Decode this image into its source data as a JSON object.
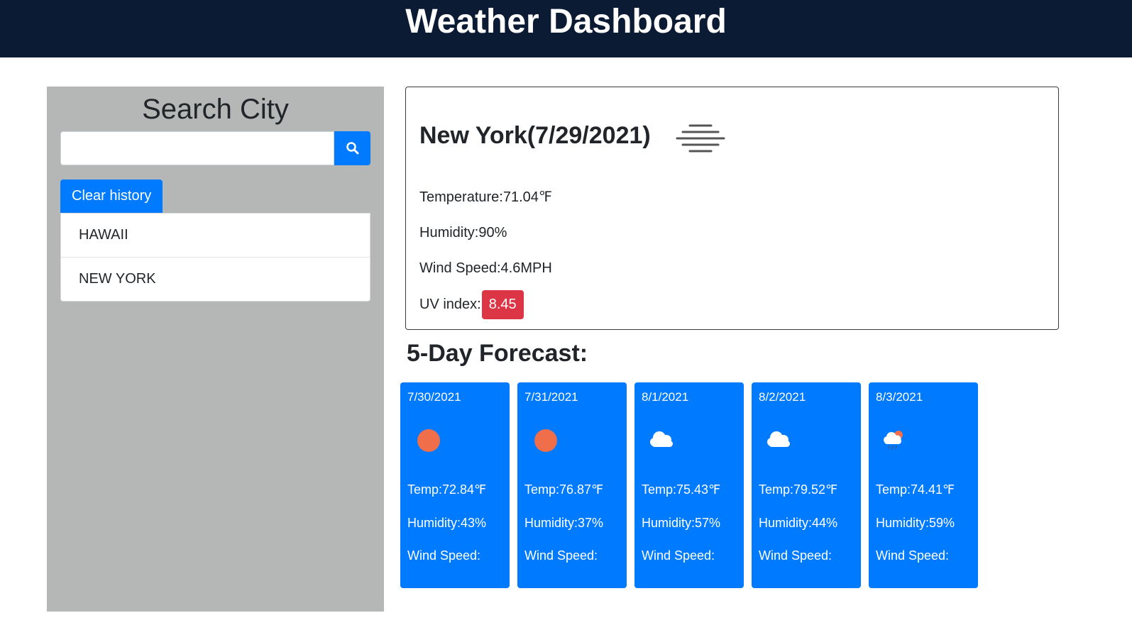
{
  "header": {
    "title": "Weather Dashboard"
  },
  "sidebar": {
    "heading": "Search City",
    "search": {
      "value": "",
      "placeholder": ""
    },
    "search_icon": "search-icon",
    "clear_label": "Clear history",
    "history": [
      "HAWAII",
      "NEW YORK"
    ]
  },
  "current": {
    "title": "New York(7/29/2021)",
    "icon": "mist-icon",
    "temperature": "Temperature:71.04℉",
    "humidity": "Humidity:90%",
    "wind": "Wind Speed:4.6MPH",
    "uv_label": "UV index:",
    "uv_value": "8.45",
    "uv_color": "#dc3545"
  },
  "forecast": {
    "title": "5-Day Forecast:",
    "days": [
      {
        "date": "7/30/2021",
        "icon": "sun-icon",
        "temp": "Temp:72.84℉",
        "humidity": "Humidity:43%",
        "wind": "Wind Speed:"
      },
      {
        "date": "7/31/2021",
        "icon": "sun-icon",
        "temp": "Temp:76.87℉",
        "humidity": "Humidity:37%",
        "wind": "Wind Speed:"
      },
      {
        "date": "8/1/2021",
        "icon": "cloud-icon",
        "temp": "Temp:75.43℉",
        "humidity": "Humidity:57%",
        "wind": "Wind Speed:"
      },
      {
        "date": "8/2/2021",
        "icon": "cloud-icon",
        "temp": "Temp:79.52℉",
        "humidity": "Humidity:44%",
        "wind": "Wind Speed:"
      },
      {
        "date": "8/3/2021",
        "icon": "rain-sun-icon",
        "temp": "Temp:74.41℉",
        "humidity": "Humidity:59%",
        "wind": "Wind Speed:"
      }
    ]
  },
  "colors": {
    "header_bg": "#0b1b34",
    "accent": "#007bff",
    "sidebar_bg": "#b5b7b6",
    "sun": "#f06e4a"
  }
}
